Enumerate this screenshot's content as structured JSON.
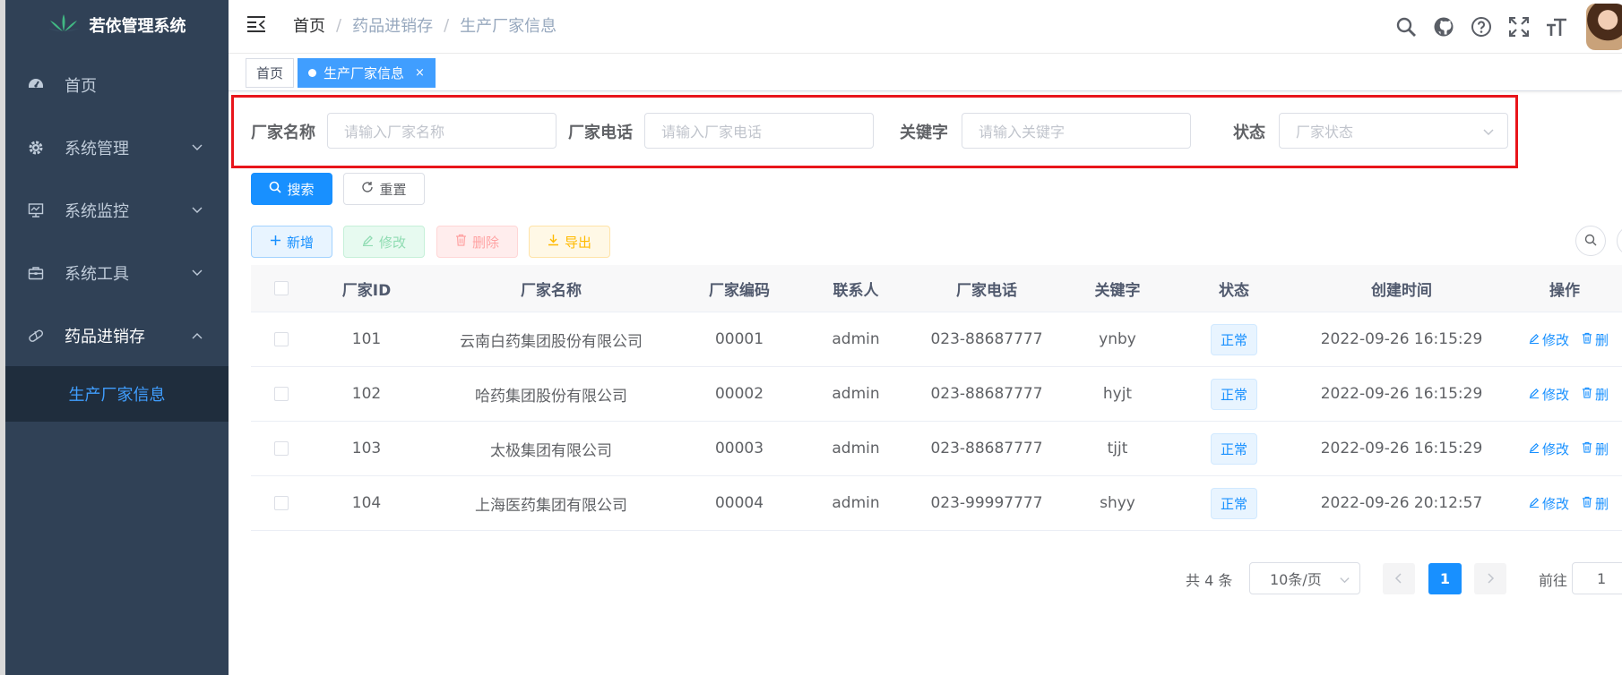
{
  "app": {
    "title": "若依管理系统"
  },
  "sidebar": {
    "items": [
      {
        "label": "首页",
        "icon": "dashboard-icon"
      },
      {
        "label": "系统管理",
        "icon": "gear-icon"
      },
      {
        "label": "系统监控",
        "icon": "monitor-icon"
      },
      {
        "label": "系统工具",
        "icon": "toolbox-icon"
      },
      {
        "label": "药品进销存",
        "icon": "pill-icon"
      }
    ],
    "sub_item": "生产厂家信息"
  },
  "breadcrumb": [
    "首页",
    "药品进销存",
    "生产厂家信息"
  ],
  "tags": {
    "home": "首页",
    "active": "生产厂家信息",
    "close": "×"
  },
  "search": {
    "name_label": "厂家名称",
    "name_placeholder": "请输入厂家名称",
    "phone_label": "厂家电话",
    "phone_placeholder": "请输入厂家电话",
    "keyword_label": "关键字",
    "keyword_placeholder": "请输入关键字",
    "status_label": "状态",
    "status_placeholder": "厂家状态",
    "search_btn": "搜索",
    "reset_btn": "重置"
  },
  "toolbar": {
    "add": "新增",
    "edit": "修改",
    "delete": "删除",
    "export": "导出"
  },
  "table": {
    "columns": [
      "厂家ID",
      "厂家名称",
      "厂家编码",
      "联系人",
      "厂家电话",
      "关键字",
      "状态",
      "创建时间",
      "操作"
    ],
    "rows": [
      {
        "id": "101",
        "name": "云南白药集团股份有限公司",
        "code": "00001",
        "contact": "admin",
        "phone": "023-88687777",
        "keyword": "ynby",
        "status": "正常",
        "created": "2022-09-26 16:15:29"
      },
      {
        "id": "102",
        "name": "哈药集团股份有限公司",
        "code": "00002",
        "contact": "admin",
        "phone": "023-88687777",
        "keyword": "hyjt",
        "status": "正常",
        "created": "2022-09-26 16:15:29"
      },
      {
        "id": "103",
        "name": "太极集团有限公司",
        "code": "00003",
        "contact": "admin",
        "phone": "023-88687777",
        "keyword": "tjjt",
        "status": "正常",
        "created": "2022-09-26 16:15:29"
      },
      {
        "id": "104",
        "name": "上海医药集团有限公司",
        "code": "00004",
        "contact": "admin",
        "phone": "023-99997777",
        "keyword": "shyy",
        "status": "正常",
        "created": "2022-09-26 20:12:57"
      }
    ],
    "op_edit": "修改",
    "op_delete": "删"
  },
  "pagination": {
    "total": "共 4 条",
    "page_size": "10条/页",
    "current": "1",
    "goto": "前往",
    "goto_value": "1"
  },
  "colors": {
    "primary": "#1890ff",
    "sidebar_bg": "#304156",
    "highlight_border": "#e8151b"
  }
}
